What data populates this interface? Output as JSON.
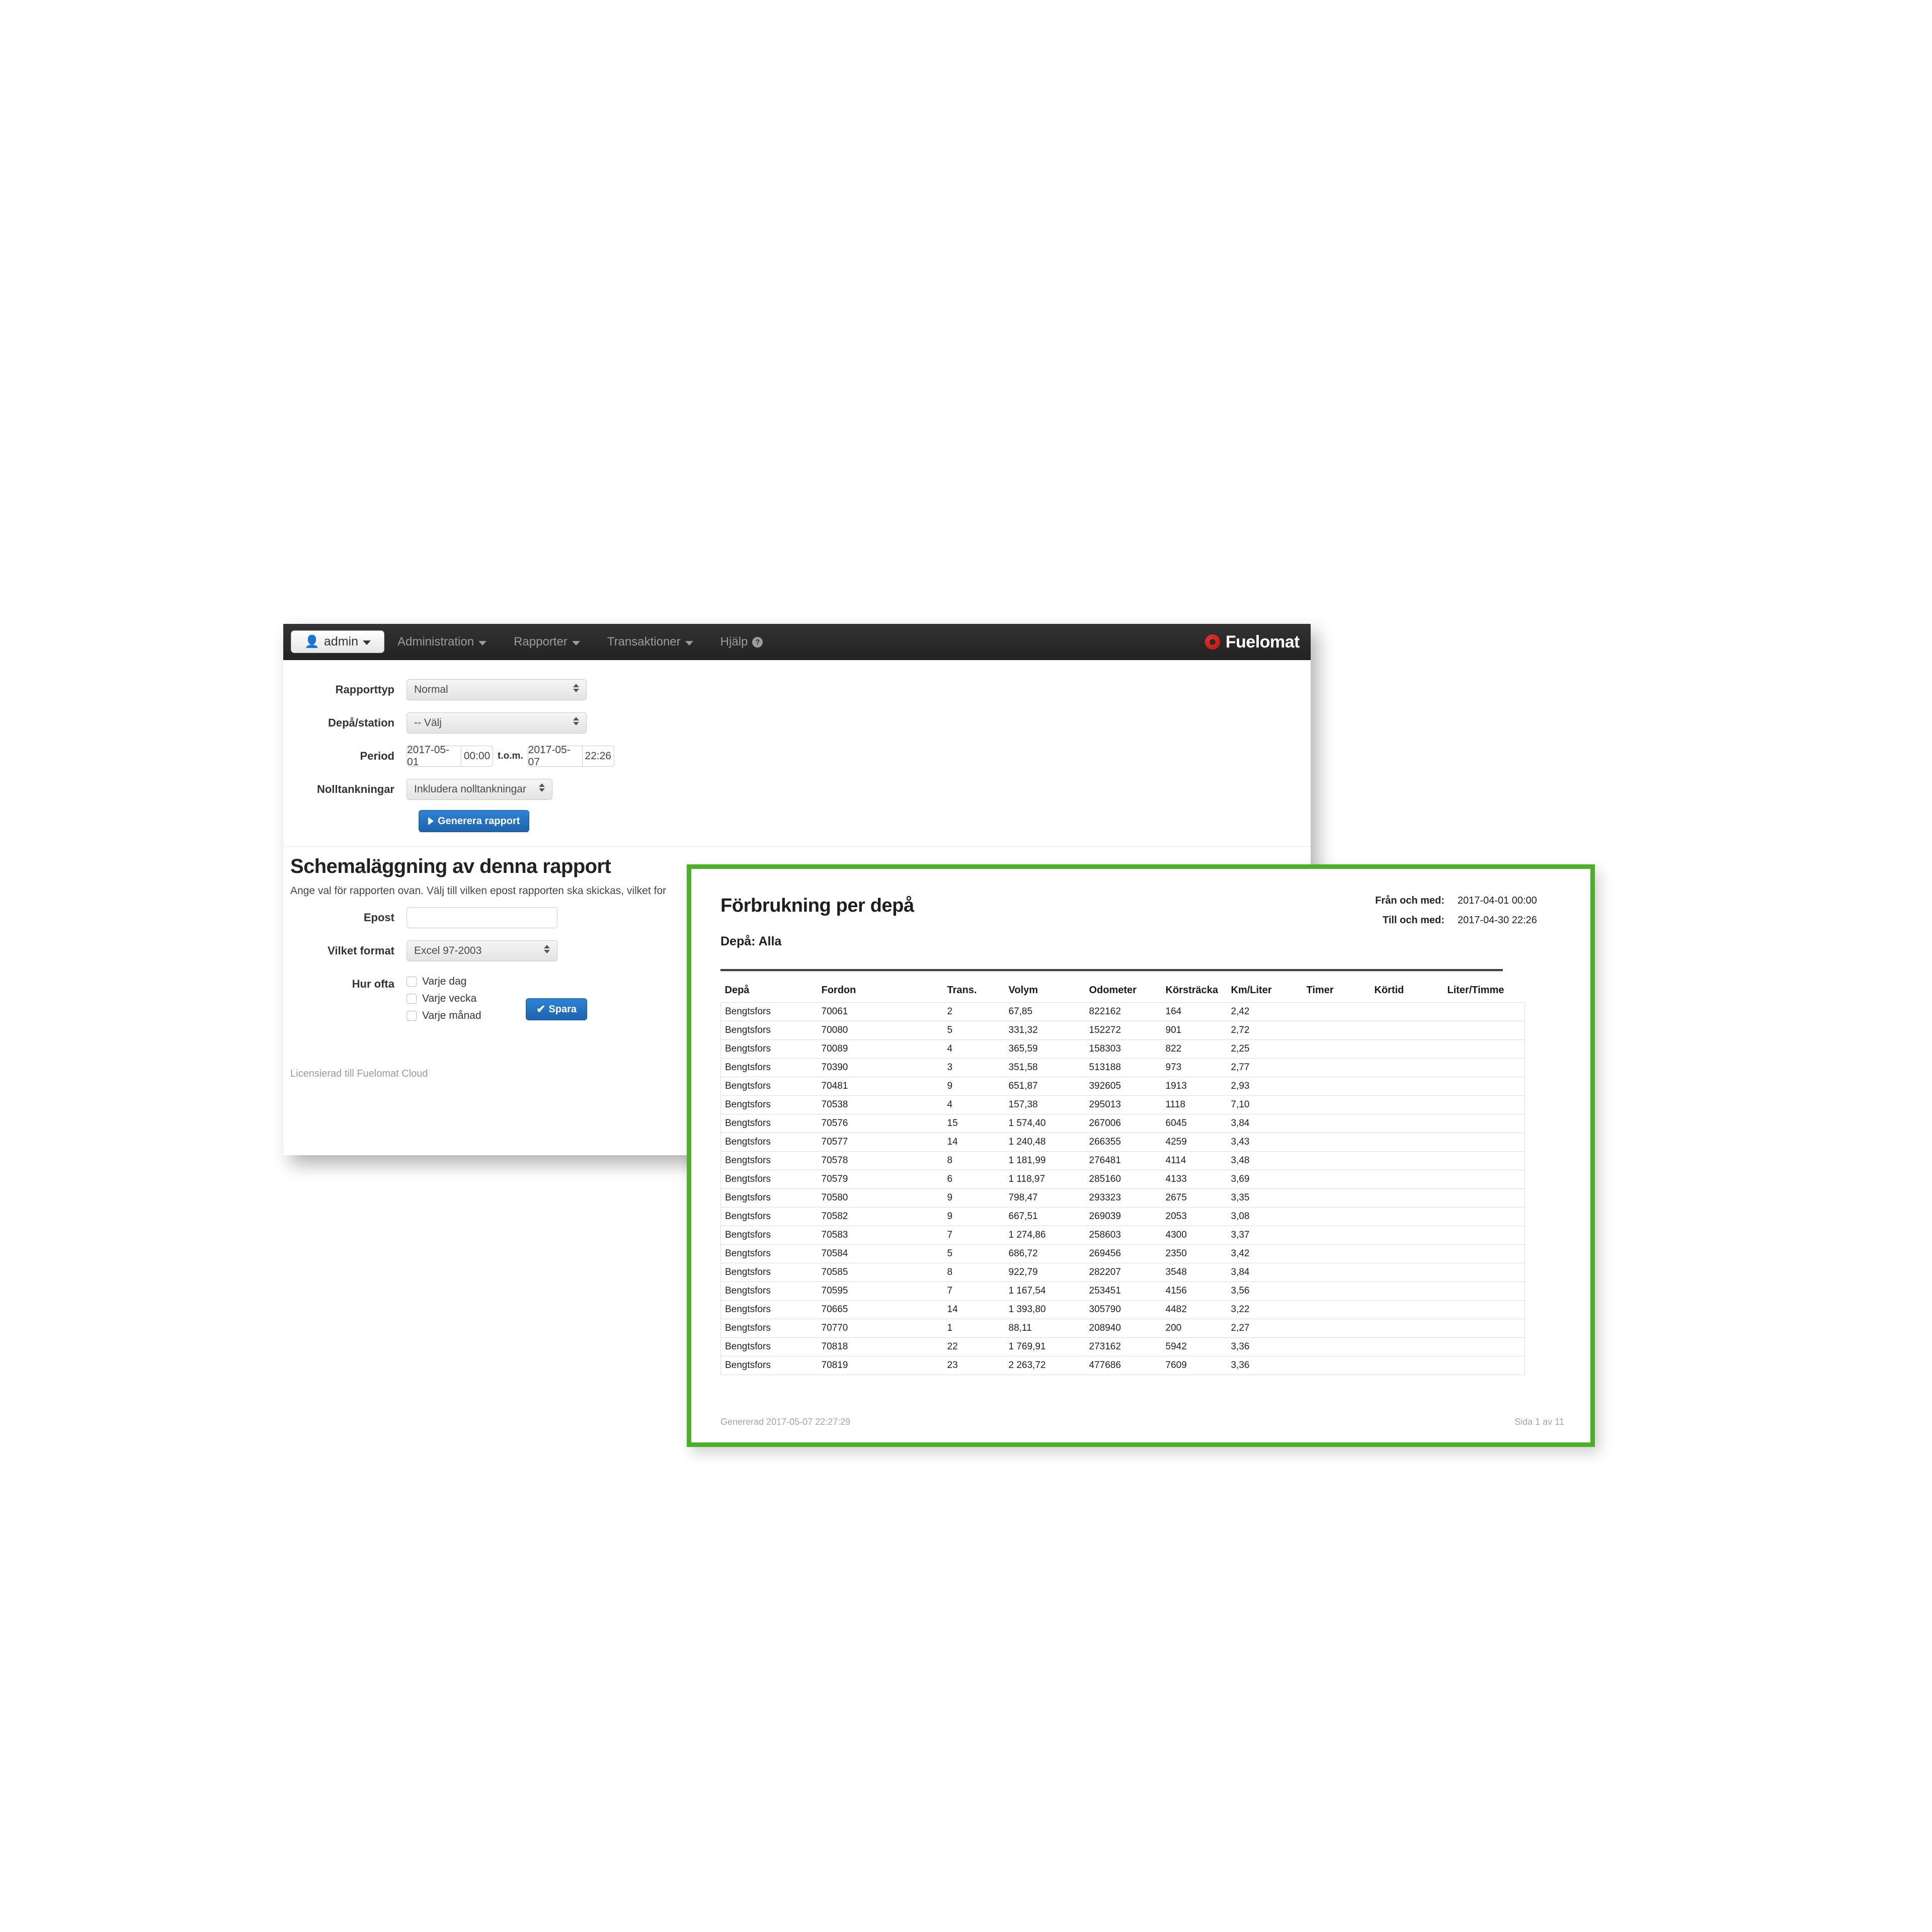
{
  "navbar": {
    "brand_button": {
      "label": "admin",
      "icon": "user-icon",
      "caret": "chevron-down-icon"
    },
    "items": [
      {
        "label": "Administration",
        "has_caret": true
      },
      {
        "label": "Rapporter",
        "has_caret": true
      },
      {
        "label": "Transaktioner",
        "has_caret": true
      },
      {
        "label": "Hjälp",
        "has_caret": false,
        "badge": "?"
      }
    ],
    "logo": {
      "text": "Fuelomat",
      "icon": "fuelomat-ring-logo",
      "color": "#cf1f18"
    },
    "background_color": "#2b2b2b"
  },
  "param_form": {
    "rows": [
      {
        "label": "Rapporttyp",
        "type": "select",
        "value": "Normal"
      },
      {
        "label": "Depå/station",
        "type": "select",
        "value": "-- Välj"
      },
      {
        "label": "Period",
        "type": "period",
        "from_date": "2017-05-01",
        "from_time": "00:00",
        "separator": "t.o.m.",
        "to_date": "2017-05-07",
        "to_time": "22:26"
      },
      {
        "label": "Nolltankningar",
        "type": "select",
        "value": "Inkludera nolltankningar"
      }
    ],
    "generate_button": {
      "label": "Generera rapport",
      "icon": "play-icon",
      "color": "#1e63ad"
    }
  },
  "scheduling": {
    "title": "Schemaläggning av denna rapport",
    "description": "Ange val för rapporten ovan. Välj till vilken epost rapporten ska skickas, vilket for",
    "email": {
      "label": "Epost",
      "value": "",
      "placeholder": ""
    },
    "format": {
      "label": "Vilket format",
      "value": "Excel 97-2003"
    },
    "frequency": {
      "label": "Hur ofta",
      "options": [
        {
          "label": "Varje dag",
          "checked": false
        },
        {
          "label": "Varje vecka",
          "checked": false
        },
        {
          "label": "Varje månad",
          "checked": false
        }
      ]
    },
    "save_button": {
      "label": "Spara",
      "icon": "check-icon",
      "color": "#1e63ad"
    },
    "license_note": "Licensierad till Fuelomat Cloud"
  },
  "report": {
    "frame_color": "#4caf27",
    "title": "Förbrukning per depå",
    "meta": [
      {
        "key": "Från och med:",
        "value": "2017-04-01 00:00"
      },
      {
        "key": "Till och med:",
        "value": "2017-04-30 22:26"
      }
    ],
    "depot_line": "Depå: Alla",
    "footer_left": "Genererad 2017-05-07 22:27:29",
    "footer_right": "Sida 1 av 11"
  },
  "chart_data": {
    "type": "table",
    "title": "Förbrukning per depå",
    "columns": [
      "Depå",
      "Fordon",
      "Trans.",
      "Volym",
      "Odometer",
      "Körsträcka",
      "Km/Liter",
      "Timer",
      "Körtid",
      "Liter/Timme"
    ],
    "rows": [
      [
        "Bengtsfors",
        "70061",
        "2",
        "67,85",
        "822162",
        "164",
        "2,42",
        "",
        "",
        ""
      ],
      [
        "Bengtsfors",
        "70080",
        "5",
        "331,32",
        "152272",
        "901",
        "2,72",
        "",
        "",
        ""
      ],
      [
        "Bengtsfors",
        "70089",
        "4",
        "365,59",
        "158303",
        "822",
        "2,25",
        "",
        "",
        ""
      ],
      [
        "Bengtsfors",
        "70390",
        "3",
        "351,58",
        "513188",
        "973",
        "2,77",
        "",
        "",
        ""
      ],
      [
        "Bengtsfors",
        "70481",
        "9",
        "651,87",
        "392605",
        "1913",
        "2,93",
        "",
        "",
        ""
      ],
      [
        "Bengtsfors",
        "70538",
        "4",
        "157,38",
        "295013",
        "1118",
        "7,10",
        "",
        "",
        ""
      ],
      [
        "Bengtsfors",
        "70576",
        "15",
        "1 574,40",
        "267006",
        "6045",
        "3,84",
        "",
        "",
        ""
      ],
      [
        "Bengtsfors",
        "70577",
        "14",
        "1 240,48",
        "266355",
        "4259",
        "3,43",
        "",
        "",
        ""
      ],
      [
        "Bengtsfors",
        "70578",
        "8",
        "1 181,99",
        "276481",
        "4114",
        "3,48",
        "",
        "",
        ""
      ],
      [
        "Bengtsfors",
        "70579",
        "6",
        "1 118,97",
        "285160",
        "4133",
        "3,69",
        "",
        "",
        ""
      ],
      [
        "Bengtsfors",
        "70580",
        "9",
        "798,47",
        "293323",
        "2675",
        "3,35",
        "",
        "",
        ""
      ],
      [
        "Bengtsfors",
        "70582",
        "9",
        "667,51",
        "269039",
        "2053",
        "3,08",
        "",
        "",
        ""
      ],
      [
        "Bengtsfors",
        "70583",
        "7",
        "1 274,86",
        "258603",
        "4300",
        "3,37",
        "",
        "",
        ""
      ],
      [
        "Bengtsfors",
        "70584",
        "5",
        "686,72",
        "269456",
        "2350",
        "3,42",
        "",
        "",
        ""
      ],
      [
        "Bengtsfors",
        "70585",
        "8",
        "922,79",
        "282207",
        "3548",
        "3,84",
        "",
        "",
        ""
      ],
      [
        "Bengtsfors",
        "70595",
        "7",
        "1 167,54",
        "253451",
        "4156",
        "3,56",
        "",
        "",
        ""
      ],
      [
        "Bengtsfors",
        "70665",
        "14",
        "1 393,80",
        "305790",
        "4482",
        "3,22",
        "",
        "",
        ""
      ],
      [
        "Bengtsfors",
        "70770",
        "1",
        "88,11",
        "208940",
        "200",
        "2,27",
        "",
        "",
        ""
      ],
      [
        "Bengtsfors",
        "70818",
        "22",
        "1 769,91",
        "273162",
        "5942",
        "3,36",
        "",
        "",
        ""
      ],
      [
        "Bengtsfors",
        "70819",
        "23",
        "2 263,72",
        "477686",
        "7609",
        "3,36",
        "",
        "",
        ""
      ]
    ]
  }
}
